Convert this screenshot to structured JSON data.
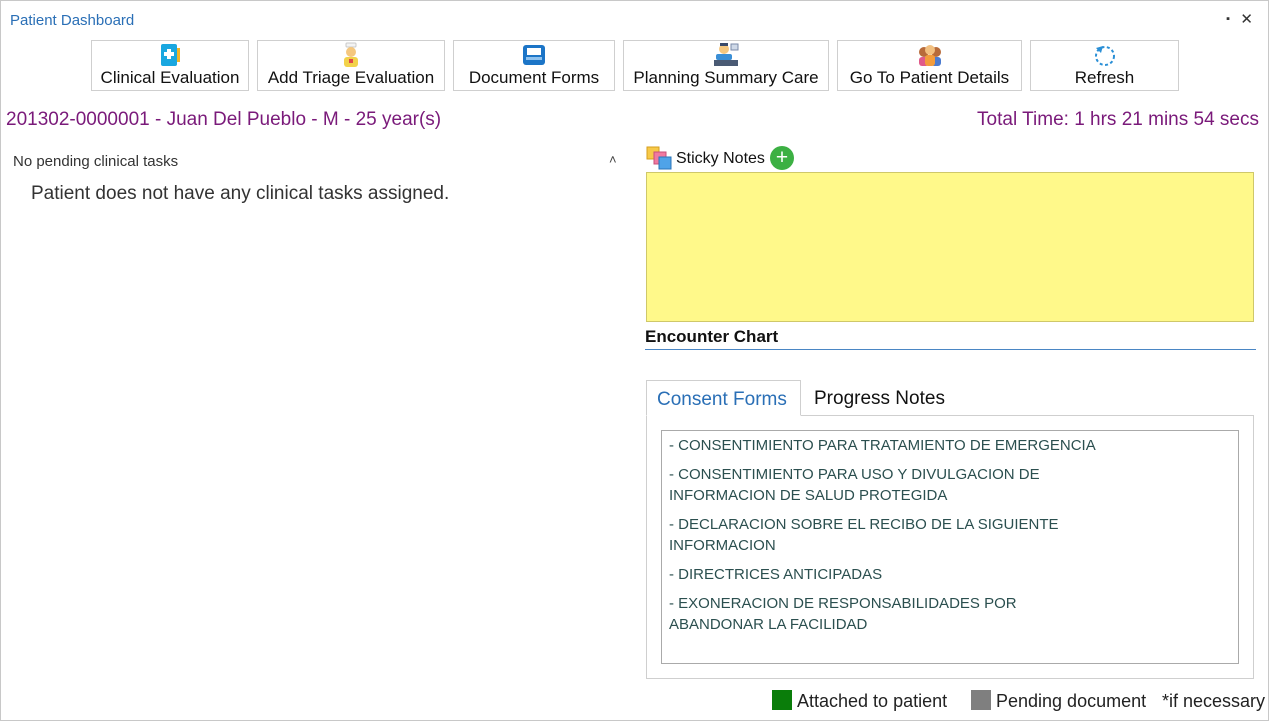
{
  "window": {
    "title": "Patient Dashboard",
    "pin_glyph": "▪",
    "close_glyph": "✕"
  },
  "toolbar": {
    "buttons": [
      {
        "label": "Clinical Evaluation",
        "icon": "clipboard-icon"
      },
      {
        "label": "Add Triage Evaluation",
        "icon": "nurse-icon"
      },
      {
        "label": "Document Forms",
        "icon": "inbox-tray-icon"
      },
      {
        "label": "Planning Summary Care",
        "icon": "doctor-desk-icon"
      },
      {
        "label": "Go To Patient Details",
        "icon": "patients-group-icon"
      },
      {
        "label": "Refresh",
        "icon": "refresh-icon"
      }
    ]
  },
  "patient": {
    "summary": "201302-0000001 - Juan Del Pueblo - M - 25 year(s)",
    "total_time": "Total Time: 1 hrs 21 mins 54 secs"
  },
  "tasks": {
    "header": "No pending clinical tasks",
    "caret": "˄",
    "message": "Patient does not have any clinical tasks assigned."
  },
  "sticky_notes": {
    "label": "Sticky Notes",
    "add_glyph": "+",
    "note_color": "#fff98a"
  },
  "encounter": {
    "title": "Encounter Chart",
    "tabs": [
      {
        "label": "Consent Forms",
        "active": true
      },
      {
        "label": "Progress Notes",
        "active": false
      }
    ],
    "forms": [
      "- CONSENTIMIENTO PARA TRATAMIENTO DE EMERGENCIA",
      "- CONSENTIMIENTO PARA USO Y DIVULGACION DE INFORMACION DE SALUD PROTEGIDA",
      "- DECLARACION SOBRE EL RECIBO DE LA SIGUIENTE INFORMACION",
      "- DIRECTRICES ANTICIPADAS",
      "- EXONERACION DE RESPONSABILIDADES POR ABANDONAR LA FACILIDAD"
    ]
  },
  "legend": {
    "attached_label": "Attached to patient",
    "attached_color": "#0a7d0a",
    "pending_label": "Pending document",
    "pending_color": "#7f7f7f",
    "note": "*if necessary"
  },
  "colors": {
    "accent_blue": "#2a6fb6",
    "patient_purple": "#7a1a7a"
  }
}
